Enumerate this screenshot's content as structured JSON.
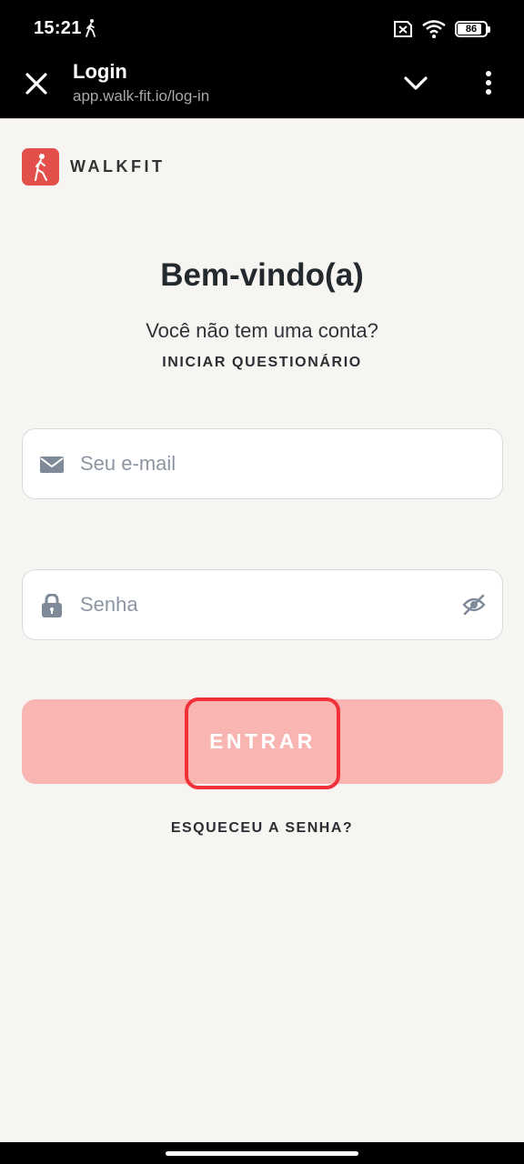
{
  "status_bar": {
    "time": "15:21",
    "battery": "86",
    "battery_level": 0.86
  },
  "browser": {
    "title": "Login",
    "url": "app.walk-fit.io/log-in"
  },
  "brand": {
    "name": "WALKFIT",
    "logo_color": "#e3504b"
  },
  "main": {
    "welcome": "Bem-vindo(a)",
    "no_account": "Você não tem uma conta?",
    "start_quiz": "INICIAR QUESTIONÁRIO",
    "email_placeholder": "Seu e-mail",
    "password_placeholder": "Senha",
    "login_label": "ENTRAR",
    "forgot": "ESQUECEU A SENHA?"
  },
  "colors": {
    "button": "#f9b5b2",
    "highlight": "#f2303a",
    "background": "#f6f5f2"
  }
}
